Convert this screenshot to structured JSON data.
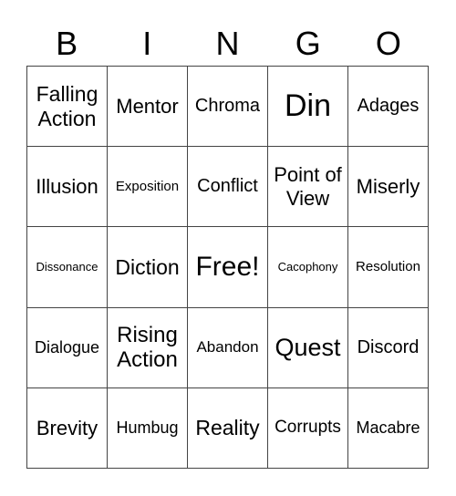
{
  "header": [
    "B",
    "I",
    "N",
    "G",
    "O"
  ],
  "cells": [
    "Falling Action",
    "Mentor",
    "Chroma",
    "Din",
    "Adages",
    "Illusion",
    "Exposition",
    "Conflict",
    "Point of View",
    "Miserly",
    "Dissonance",
    "Diction",
    "Free!",
    "Cacophony",
    "Resolution",
    "Dialogue",
    "Rising Action",
    "Abandon",
    "Quest",
    "Discord",
    "Brevity",
    "Humbug",
    "Reality",
    "Corrupts",
    "Macabre"
  ]
}
